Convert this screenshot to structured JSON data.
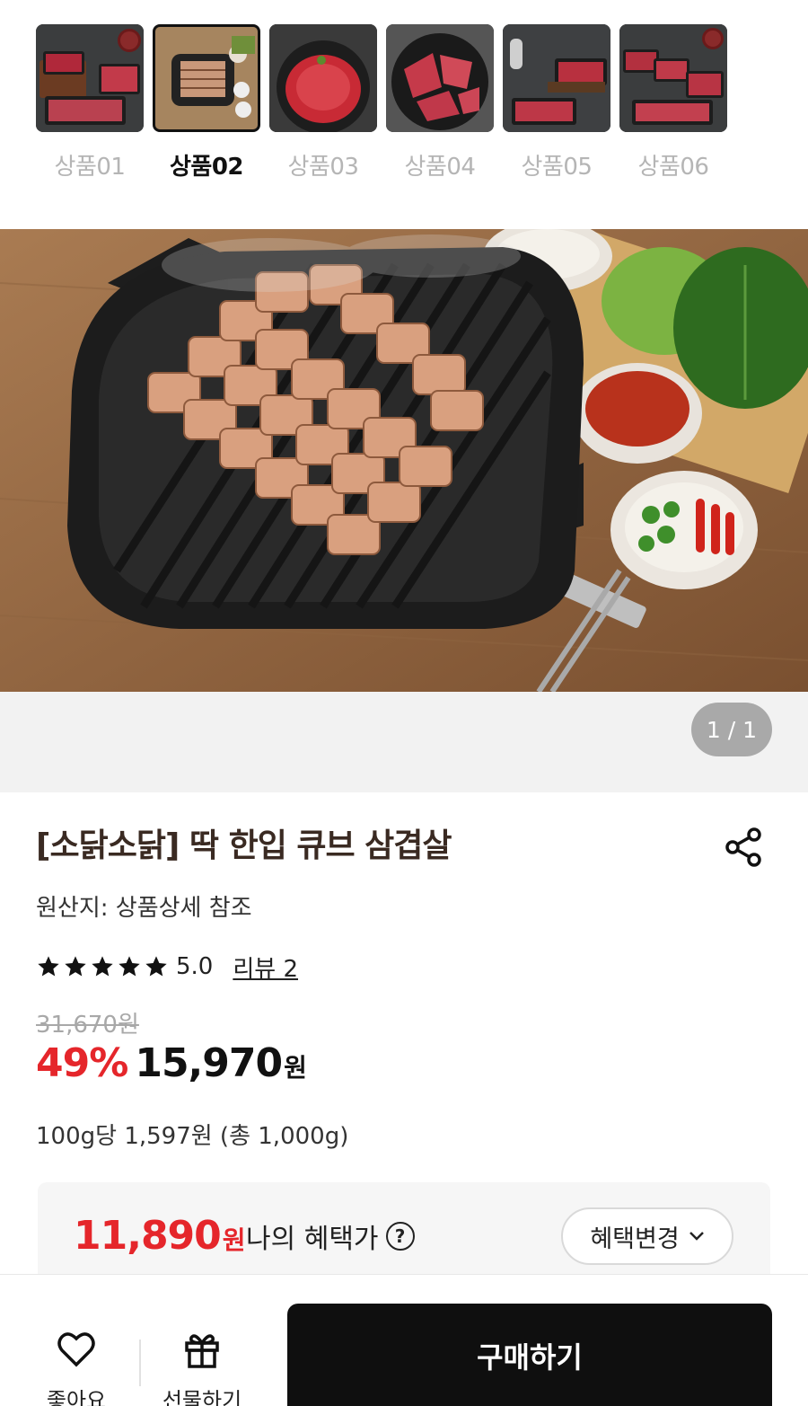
{
  "thumbnails": [
    {
      "label": "상품01",
      "selected": false
    },
    {
      "label": "상품02",
      "selected": true
    },
    {
      "label": "상품03",
      "selected": false
    },
    {
      "label": "상품04",
      "selected": false
    },
    {
      "label": "상품05",
      "selected": false
    },
    {
      "label": "상품06",
      "selected": false
    }
  ],
  "gallery": {
    "pager": "1 / 1"
  },
  "product": {
    "title": "[소닭소닭] 딱 한입 큐브 삼겹살",
    "origin": "원산지: 상품상세 참조",
    "rating": {
      "stars": 5,
      "score": "5.0",
      "reviews": "리뷰 2"
    },
    "original_price": "31,670원",
    "discount": "49%",
    "price": "15,970",
    "price_unit": "원",
    "unit_price": "100g당 1,597원 (총 1,000g)"
  },
  "benefit": {
    "price": "11,890",
    "unit": "원",
    "label": "나의 혜택가",
    "help": "?",
    "change_label": "혜택변경"
  },
  "bottom_bar": {
    "like_label": "좋아요",
    "gift_label": "선물하기",
    "buy_label": "구매하기"
  },
  "colors": {
    "accent": "#e5262b",
    "buy_button": "#0f0f0f",
    "title": "#3a2a22"
  },
  "icons": [
    "share-icon",
    "star-icon",
    "question-icon",
    "chevron-down-icon",
    "heart-icon",
    "gift-icon"
  ]
}
